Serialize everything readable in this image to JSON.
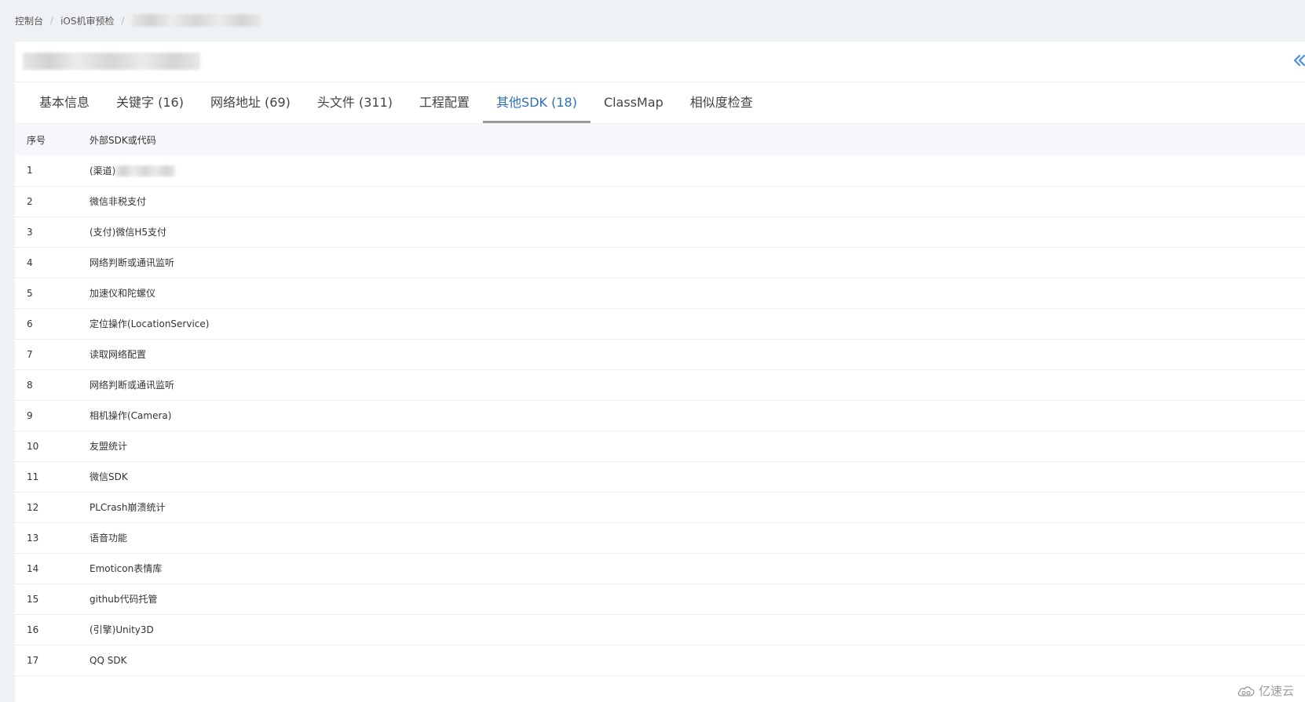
{
  "breadcrumb": {
    "items": [
      "控制台",
      "iOS机审预检"
    ],
    "separator": "/"
  },
  "tabs": [
    {
      "label": "基本信息",
      "active": false
    },
    {
      "label": "关键字 (16)",
      "active": false
    },
    {
      "label": "网络地址 (69)",
      "active": false
    },
    {
      "label": "头文件 (311)",
      "active": false
    },
    {
      "label": "工程配置",
      "active": false
    },
    {
      "label": "其他SDK (18)",
      "active": true
    },
    {
      "label": "ClassMap",
      "active": false
    },
    {
      "label": "相似度检查",
      "active": false
    }
  ],
  "table": {
    "headers": [
      "序号",
      "外部SDK或代码"
    ],
    "rows": [
      {
        "idx": "1",
        "name": "(渠道)"
      },
      {
        "idx": "2",
        "name": "微信非税支付"
      },
      {
        "idx": "3",
        "name": "(支付)微信H5支付"
      },
      {
        "idx": "4",
        "name": "网络判断或通讯监听"
      },
      {
        "idx": "5",
        "name": "加速仪和陀螺仪"
      },
      {
        "idx": "6",
        "name": "定位操作(LocationService)"
      },
      {
        "idx": "7",
        "name": "读取网络配置"
      },
      {
        "idx": "8",
        "name": "网络判断或通讯监听"
      },
      {
        "idx": "9",
        "name": "相机操作(Camera)"
      },
      {
        "idx": "10",
        "name": "友盟统计"
      },
      {
        "idx": "11",
        "name": "微信SDK"
      },
      {
        "idx": "12",
        "name": "PLCrash崩溃统计"
      },
      {
        "idx": "13",
        "name": "语音功能"
      },
      {
        "idx": "14",
        "name": "Emoticon表情库"
      },
      {
        "idx": "15",
        "name": "github代码托管"
      },
      {
        "idx": "16",
        "name": "(引擎)Unity3D"
      },
      {
        "idx": "17",
        "name": "QQ SDK"
      }
    ]
  },
  "watermark": {
    "text": "亿速云"
  },
  "colors": {
    "page_bg": "#eff2f5",
    "active_tab": "#2a6fb8",
    "active_indicator": "#9a9a9a",
    "back_icon": "#4a90e2"
  }
}
